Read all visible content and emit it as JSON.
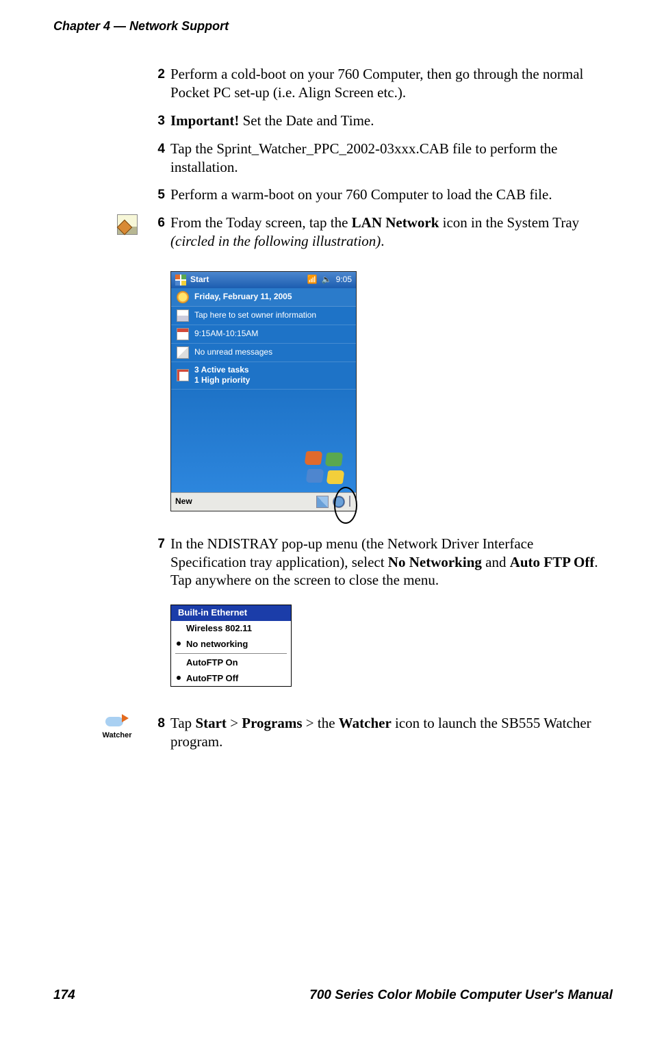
{
  "running_head": {
    "chapter": "Chapter 4",
    "dash": "—",
    "title": "Network Support"
  },
  "steps": {
    "s2": {
      "num": "2",
      "text": "Perform a cold-boot on your 760 Computer, then go through the normal Pocket PC set-up (i.e. Align Screen etc.)."
    },
    "s3": {
      "num": "3",
      "lead": "Important!",
      "text": " Set the Date and Time."
    },
    "s4": {
      "num": "4",
      "text": "Tap the Sprint_Watcher_PPC_2002-03xxx.CAB file to perform the installation."
    },
    "s5": {
      "num": "5",
      "text": "Perform a warm-boot on your 760 Computer to load the CAB file."
    },
    "s6": {
      "num": "6",
      "pre": "From the Today screen, tap the ",
      "bold": "LAN Network",
      "post": " icon in the System Tray ",
      "ital": "(circled in the following illustration)",
      "tail": "."
    },
    "s7": {
      "num": "7",
      "pre": "In the NDISTRAY pop-up menu (the Network Driver Interface Specification tray application), select ",
      "b1": "No Networking",
      "mid": " and ",
      "b2": "Auto FTP Off",
      "post": ". Tap anywhere on the screen to close the menu."
    },
    "s8": {
      "num": "8",
      "p1": "Tap ",
      "b1": "Start",
      "p2": " > ",
      "b2": "Programs",
      "p3": " > the ",
      "b3": "Watcher",
      "p4": " icon to launch the SB555 Watcher program."
    }
  },
  "ppc": {
    "title": "Start",
    "clock": "9:05",
    "rows": {
      "date": "Friday, February 11, 2005",
      "owner": "Tap here to set owner information",
      "cal": "9:15AM-10:15AM",
      "mail": "No unread messages",
      "tasks_line1": "3 Active tasks",
      "tasks_line2": "1 High priority"
    },
    "taskbar": {
      "new": "New"
    }
  },
  "ndis": {
    "header": "Built-in Ethernet",
    "wireless": "Wireless 802.11",
    "no_net": "No networking",
    "aftp_on": "AutoFTP On",
    "aftp_off": "AutoFTP Off"
  },
  "watcher_icon_label": "Watcher",
  "footer": {
    "page": "174",
    "title": "700 Series Color Mobile Computer User's Manual"
  }
}
